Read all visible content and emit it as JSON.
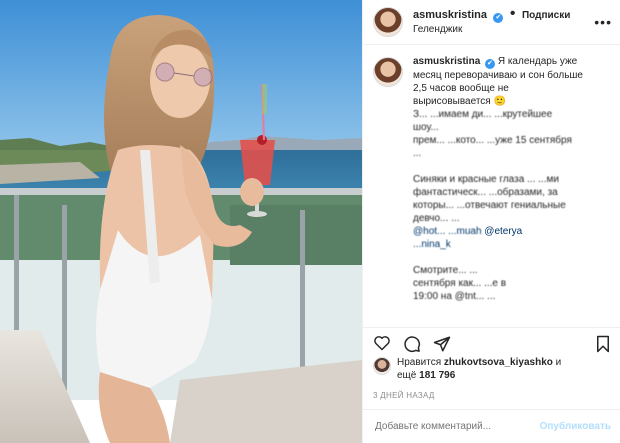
{
  "header": {
    "username": "asmuskristina",
    "verified_mark": "✔",
    "separator": "•",
    "follow_label": "Подписки",
    "location": "Геленджик",
    "more_label": "•••"
  },
  "caption": {
    "username": "asmuskristina",
    "verified_mark": "✔",
    "lines": [
      "Я календарь уже",
      "месяц переворачиваю и сон больше",
      "2,5 часов вообще не",
      "вырисовывается 🙂",
      "З... ...имаем ди... ...крутейшее",
      "шоу...",
      "прем... ...кото... ...уже 15 сентября",
      "...",
      "",
      "Синяки и красные глаза ... ...ми",
      "фантастическ... ...образами, за",
      "которы... ...отвечают гениальные",
      "девчо... ...",
      "@hot... ...muah @eterya",
      "... ...nina_k",
      "",
      "Смотрите... ...",
      "сентября как... ...е в",
      "19:00 на @tnt... ..."
    ],
    "mentions": [
      "@hot... ...muah",
      "@eterya",
      "...nina_k",
      "@tnt..."
    ]
  },
  "actions": {
    "like_icon": "heart-icon",
    "comment_icon": "comment-icon",
    "share_icon": "share-icon",
    "save_icon": "bookmark-icon"
  },
  "likes": {
    "prefix": "Нравится",
    "user": "zhukovtsova_kiyashko",
    "conj": "и",
    "rest_prefix": "ещё",
    "count": "181 796"
  },
  "timestamp": "3 ДНЕЙ НАЗАД",
  "comment_box": {
    "placeholder": "Добавьте комментарий...",
    "publish_label": "Опубликовать"
  },
  "colors": {
    "verified": "#3897f0",
    "publish_disabled": "#b2dffc",
    "meta": "#8e8e8e"
  }
}
